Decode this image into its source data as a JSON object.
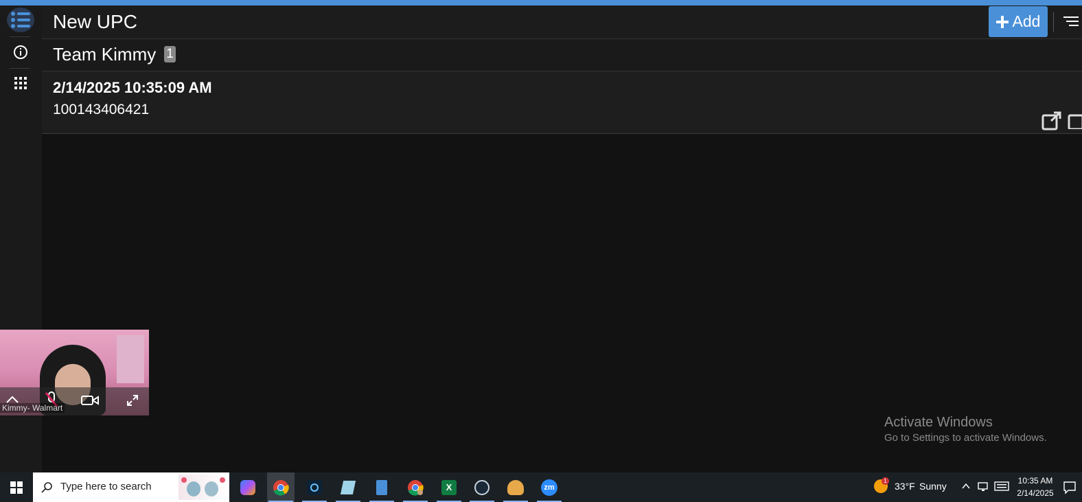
{
  "page": {
    "title": "New UPC",
    "add_label": "Add"
  },
  "team": {
    "name": "Team Kimmy",
    "count": "1"
  },
  "entries": [
    {
      "timestamp": "2/14/2025 10:35:09 AM",
      "upc": "100143406421"
    }
  ],
  "video_call": {
    "participant_label": "Kimmy- Walmart",
    "mic_state": "muted"
  },
  "windows_notice": {
    "title": "Activate Windows",
    "subtitle": "Go to Settings to activate Windows."
  },
  "taskbar": {
    "search_placeholder": "Type here to search",
    "weather_temp": "33°F",
    "weather_desc": "Sunny",
    "weather_badge": "1",
    "time": "10:35 AM",
    "date": "2/14/2025",
    "apps": [
      "copilot-icon",
      "chrome-icon",
      "app-grid-icon",
      "notes-icon",
      "calculator-icon",
      "chrome-profile-icon",
      "excel-icon",
      "steam-icon",
      "game-icon",
      "zoom-icon"
    ]
  },
  "colors": {
    "accent": "#4a90d9",
    "background": "#121212",
    "panel": "#1e1e1e"
  }
}
